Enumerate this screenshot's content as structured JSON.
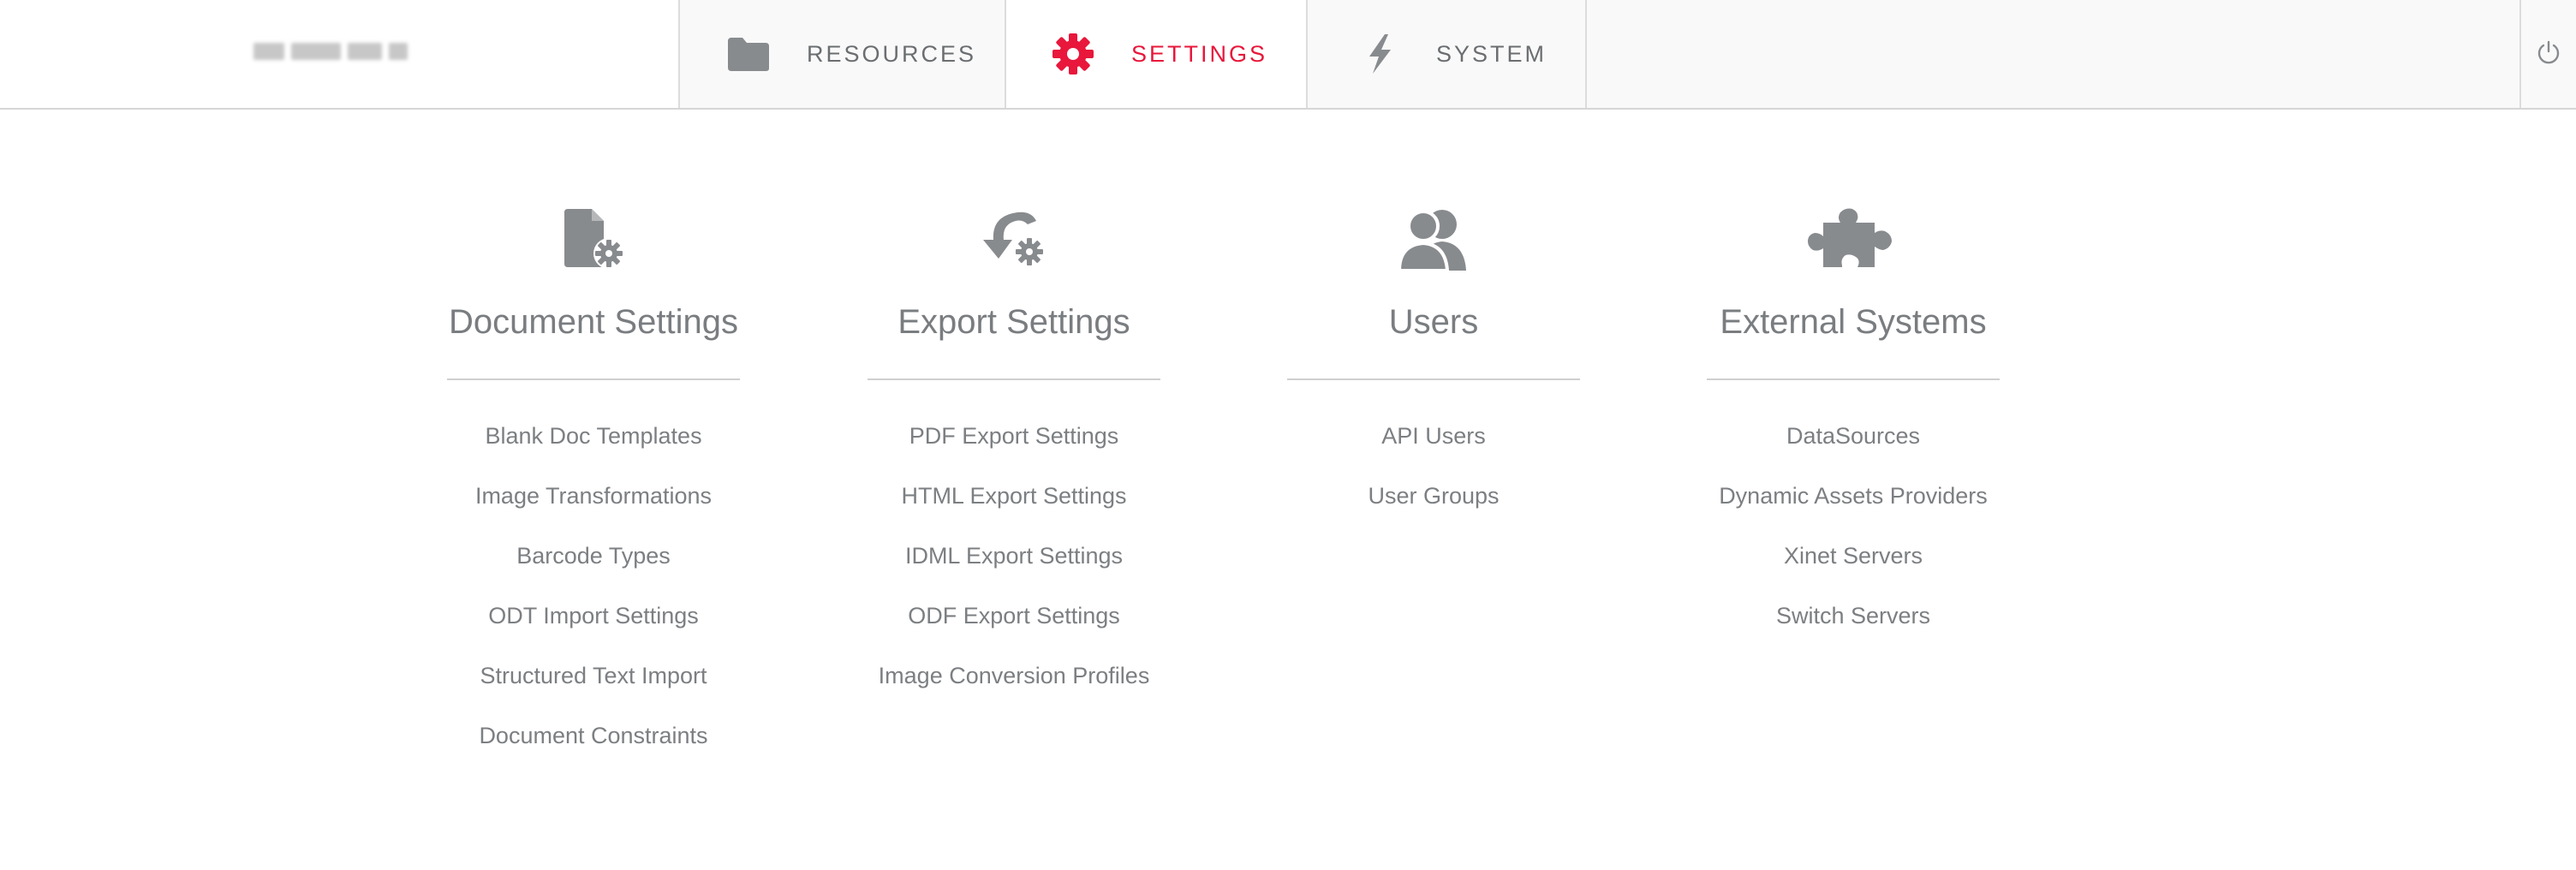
{
  "nav": {
    "tabs": [
      {
        "label": "RESOURCES",
        "icon": "folder-icon",
        "active": false
      },
      {
        "label": "SETTINGS",
        "icon": "gear-icon",
        "active": true
      },
      {
        "label": "SYSTEM",
        "icon": "lightning-icon",
        "active": false
      }
    ],
    "power_icon": "power-icon",
    "active_color": "#e8173b",
    "icon_color": "#888b8e"
  },
  "sections": [
    {
      "title": "Document Settings",
      "icon": "document-settings-icon",
      "links": [
        "Blank Doc Templates",
        "Image Transformations",
        "Barcode Types",
        "ODT Import Settings",
        "Structured Text Import",
        "Document Constraints"
      ]
    },
    {
      "title": "Export Settings",
      "icon": "export-settings-icon",
      "links": [
        "PDF Export Settings",
        "HTML Export Settings",
        "IDML Export Settings",
        "ODF Export Settings",
        "Image Conversion Profiles"
      ]
    },
    {
      "title": "Users",
      "icon": "users-icon",
      "links": [
        "API Users",
        "User Groups"
      ]
    },
    {
      "title": "External Systems",
      "icon": "puzzle-icon",
      "links": [
        "DataSources",
        "Dynamic Assets Providers",
        "Xinet Servers",
        "Switch Servers"
      ]
    }
  ]
}
